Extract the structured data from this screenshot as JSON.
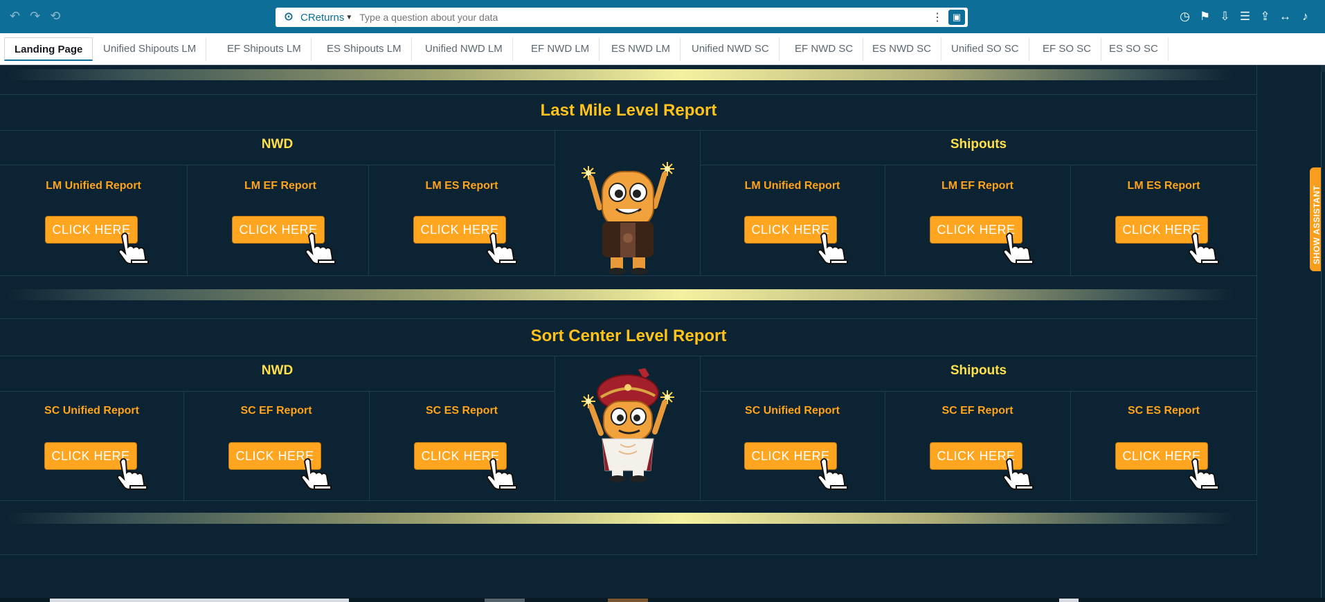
{
  "topbar": {
    "nav": [
      {
        "icon": "undo-icon",
        "glyph": "↶"
      },
      {
        "icon": "redo-icon",
        "glyph": "↷"
      },
      {
        "icon": "reset-icon",
        "glyph": "⟲"
      }
    ],
    "search": {
      "dataset": "CReturns",
      "placeholder": "Type a question about your data"
    },
    "actions": [
      {
        "icon": "schedule-icon",
        "glyph": "◷"
      },
      {
        "icon": "bookmark-icon",
        "glyph": "⚑"
      },
      {
        "icon": "download-icon",
        "glyph": "⇩"
      },
      {
        "icon": "database-icon",
        "glyph": "☰"
      },
      {
        "icon": "share-icon",
        "glyph": "⇪"
      },
      {
        "icon": "fit-width-icon",
        "glyph": "↔"
      },
      {
        "icon": "alerts-icon",
        "glyph": "♪"
      }
    ]
  },
  "tabs": [
    "Landing Page",
    "Unified Shipouts LM",
    "EF Shipouts LM",
    "ES Shipouts LM",
    "Unified NWD LM",
    "EF NWD LM",
    "ES NWD LM",
    "Unified NWD SC",
    "EF NWD SC",
    "ES NWD SC",
    "Unified SO SC",
    "EF SO SC",
    "ES SO SC"
  ],
  "active_tab": "Landing Page",
  "sections": [
    {
      "title": "Last Mile Level Report",
      "left_group": "NWD",
      "right_group": "Shipouts",
      "left_reports": [
        "LM Unified Report",
        "LM EF Report",
        "LM ES Report"
      ],
      "right_reports": [
        "LM Unified Report",
        "LM EF Report",
        "LM ES Report"
      ],
      "mascot": "mascot-casual"
    },
    {
      "title": "Sort Center Level Report",
      "left_group": "NWD",
      "right_group": "Shipouts",
      "left_reports": [
        "SC Unified Report",
        "SC EF Report",
        "SC ES Report"
      ],
      "right_reports": [
        "SC Unified Report",
        "SC EF Report",
        "SC ES Report"
      ],
      "mascot": "mascot-turban"
    }
  ],
  "button_label": "CLICK  HERE",
  "assistant_tab": "SHOW ASSISTANT",
  "colors": {
    "topbar": "#0d6e98",
    "canvas": "#0c2333",
    "section_title": "#ffc21a",
    "group_title": "#ffe04a",
    "report_label": "#ffa31a",
    "button": "#ffa51f",
    "assistant": "#f99d1c"
  }
}
